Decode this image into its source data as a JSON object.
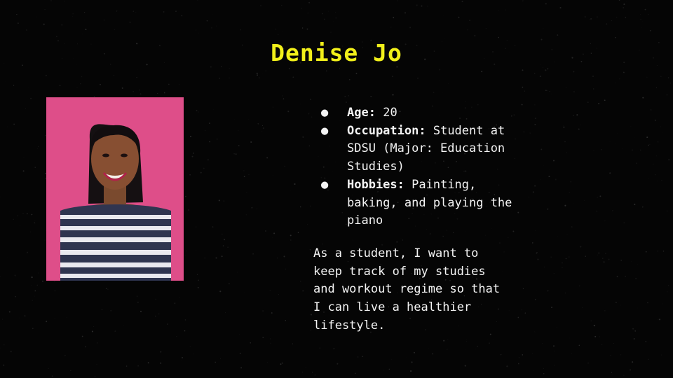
{
  "slide": {
    "title": "Denise Jo",
    "details": [
      {
        "label": "Age:",
        "value": "20"
      },
      {
        "label": "Occupation:",
        "value": "Student at SDSU (Major: Education Studies)"
      },
      {
        "label": "Hobbies:",
        "value": "Painting, baking, and playing the piano"
      }
    ],
    "user_story": "As a student, I want to\nkeep track of my studies\nand workout regime so that\nI can live a healthier\nlifestyle."
  },
  "colors": {
    "background": "#050505",
    "title": "#f2f01a",
    "text": "#f4f4f4",
    "photo_backdrop": "#df4f8a"
  },
  "icons": {
    "bullet": "black-circle"
  }
}
